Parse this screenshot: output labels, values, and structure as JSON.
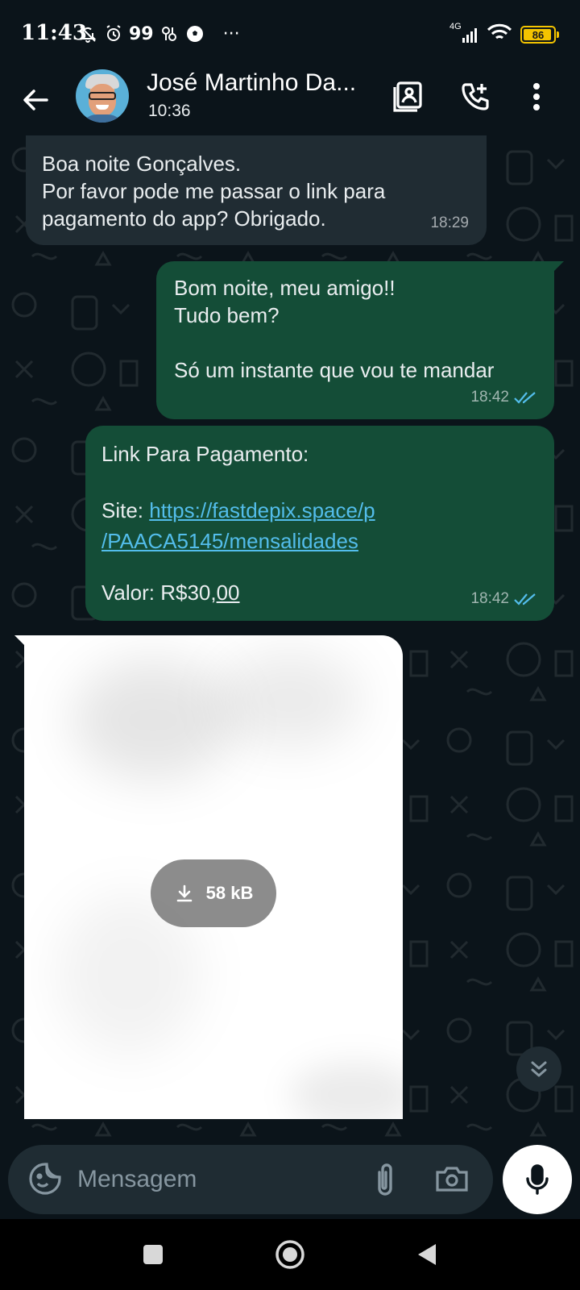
{
  "status_bar": {
    "time": "11:43",
    "notif_count": "99",
    "more": "···",
    "network": "4G",
    "battery_level": "86",
    "battery_color": "#f4c400"
  },
  "header": {
    "contact_name": "José Martinho Da...",
    "last_seen": "10:36",
    "icons": [
      "back-arrow-icon",
      "contact-card-icon",
      "add-call-icon",
      "more-vert-icon"
    ]
  },
  "messages": [
    {
      "direction": "incoming",
      "text": "Boa noite Gonçalves.\nPor favor pode me passar o link para\npagamento do app? Obrigado.",
      "time": "18:29"
    },
    {
      "direction": "outgoing",
      "text": "Bom noite, meu amigo!!\nTudo bem?\n\nSó um instante que vou te mandar",
      "time": "18:42",
      "status": "read"
    },
    {
      "direction": "outgoing",
      "title": "Link Para Pagamento:",
      "site_label": "Site: ",
      "link_line1": "https://fastdepix.space/p",
      "link_line2": "/PAACA5145/mensalidades",
      "value_prefix": "Valor: R$30,",
      "value_cents": "00",
      "time": "18:42",
      "status": "read"
    },
    {
      "direction": "incoming",
      "type": "image",
      "download_size": "58 kB"
    }
  ],
  "compose": {
    "placeholder": "Mensagem"
  },
  "colors": {
    "background": "#0b141a",
    "incoming_bubble": "#202c33",
    "outgoing_bubble": "#144d37",
    "link": "#53bdeb",
    "read_ticks": "#53bdeb"
  }
}
